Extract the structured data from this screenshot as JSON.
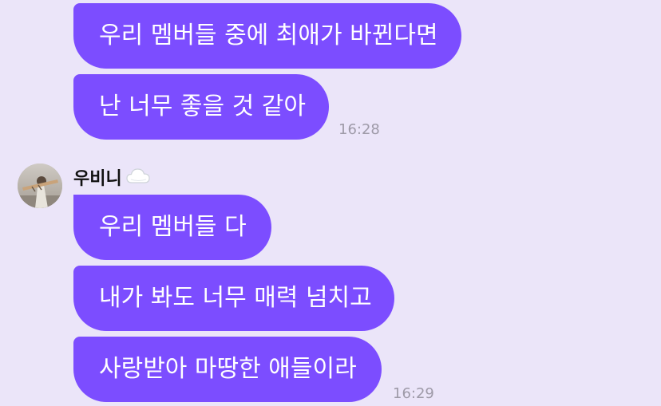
{
  "messages_prev": [
    {
      "text": "우리 멤버들 중에 최애가 바뀐다면"
    },
    {
      "text": "난 너무 좋을 것 같아"
    }
  ],
  "time_prev": "16:28",
  "sender": {
    "name": "우비니",
    "emoji_icon": "cloud-icon"
  },
  "messages_next": [
    {
      "text": "우리 멤버들 다"
    },
    {
      "text": "내가 봐도 너무 매력 넘치고"
    },
    {
      "text": "사랑받아 마땅한 애들이라"
    }
  ],
  "time_next": "16:29",
  "colors": {
    "bubble": "#7c4dff",
    "background": "#ebe5f9",
    "timestamp": "#9e9aa8"
  }
}
